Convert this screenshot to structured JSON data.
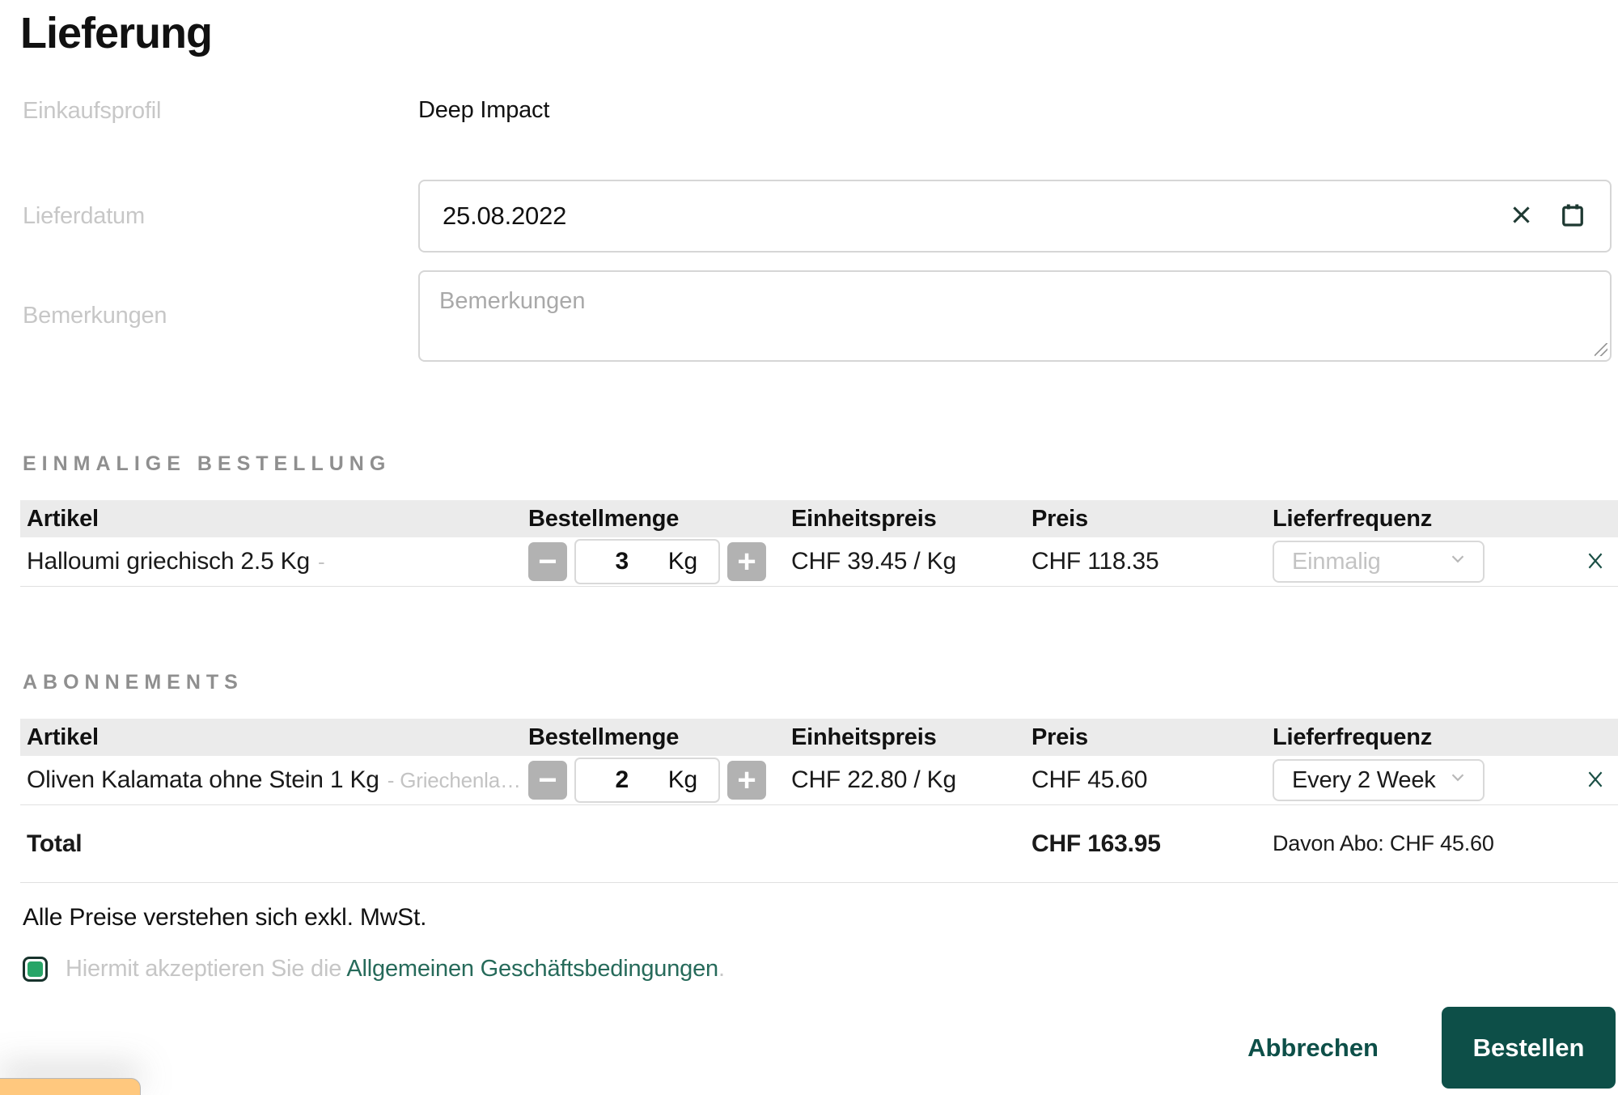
{
  "title": "Lieferung",
  "form": {
    "profile": {
      "label": "Einkaufsprofil",
      "value": "Deep Impact"
    },
    "date": {
      "label": "Lieferdatum",
      "value": "25.08.2022"
    },
    "remarks": {
      "label": "Bemerkungen",
      "placeholder": "Bemerkungen"
    }
  },
  "columns": {
    "article": "Artikel",
    "quantity": "Bestellmenge",
    "unit_price": "Einheitspreis",
    "price": "Preis",
    "frequency": "Lieferfrequenz"
  },
  "one_time": {
    "heading": "EINMALIGE BESTELLUNG",
    "row": {
      "article": "Halloumi griechisch 2.5 Kg",
      "supplier": "-",
      "quantity": "3",
      "unit": "Kg",
      "unit_price": "CHF 39.45 / Kg",
      "price": "CHF 118.35",
      "frequency": "Einmalig"
    }
  },
  "subscriptions": {
    "heading": "ABONNEMENTS",
    "row": {
      "article": "Oliven Kalamata ohne Stein 1 Kg",
      "supplier": "- Griechenla…",
      "quantity": "2",
      "unit": "Kg",
      "unit_price": "CHF 22.80 / Kg",
      "price": "CHF 45.60",
      "frequency": "Every 2 Week"
    }
  },
  "totals": {
    "label": "Total",
    "price": "CHF 163.95",
    "abo_note": "Davon Abo: CHF 45.60"
  },
  "footer": {
    "vat_note": "Alle Preise verstehen sich exkl. MwSt.",
    "terms": {
      "prefix": "Hiermit akzeptieren Sie die ",
      "link": "Allgemeinen Geschäftsbedingungen",
      "suffix": ".",
      "checked": true
    },
    "cancel_label": "Abbrechen",
    "submit_label": "Bestellen"
  },
  "stepper": {
    "decrease": "−",
    "increase": "+"
  },
  "colors": {
    "accent": "#0d4f48",
    "link_green": "#266a5a",
    "checkbox_green": "#27a567",
    "toast_yellow": "#ffc87e",
    "table_header_bg": "#ebebeb"
  }
}
